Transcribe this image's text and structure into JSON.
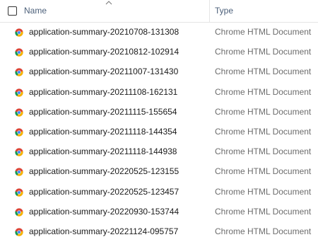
{
  "header": {
    "name_label": "Name",
    "type_label": "Type",
    "sort": "ascending"
  },
  "icons": {
    "file": "chrome-icon",
    "sort": "chevron-up-icon"
  },
  "colors": {
    "header_text": "#4c607a",
    "type_text": "#6d6d6d",
    "chrome_red": "#db4437",
    "chrome_green": "#0f9d58",
    "chrome_yellow": "#f4b400",
    "chrome_blue": "#4285f4"
  },
  "files": [
    {
      "name": "application-summary-20210708-131308",
      "type": "Chrome HTML Document"
    },
    {
      "name": "application-summary-20210812-102914",
      "type": "Chrome HTML Document"
    },
    {
      "name": "application-summary-20211007-131430",
      "type": "Chrome HTML Document"
    },
    {
      "name": "application-summary-20211108-162131",
      "type": "Chrome HTML Document"
    },
    {
      "name": "application-summary-20211115-155654",
      "type": "Chrome HTML Document"
    },
    {
      "name": "application-summary-20211118-144354",
      "type": "Chrome HTML Document"
    },
    {
      "name": "application-summary-20211118-144938",
      "type": "Chrome HTML Document"
    },
    {
      "name": "application-summary-20220525-123155",
      "type": "Chrome HTML Document"
    },
    {
      "name": "application-summary-20220525-123457",
      "type": "Chrome HTML Document"
    },
    {
      "name": "application-summary-20220930-153744",
      "type": "Chrome HTML Document"
    },
    {
      "name": "application-summary-20221124-095757",
      "type": "Chrome HTML Document"
    }
  ]
}
